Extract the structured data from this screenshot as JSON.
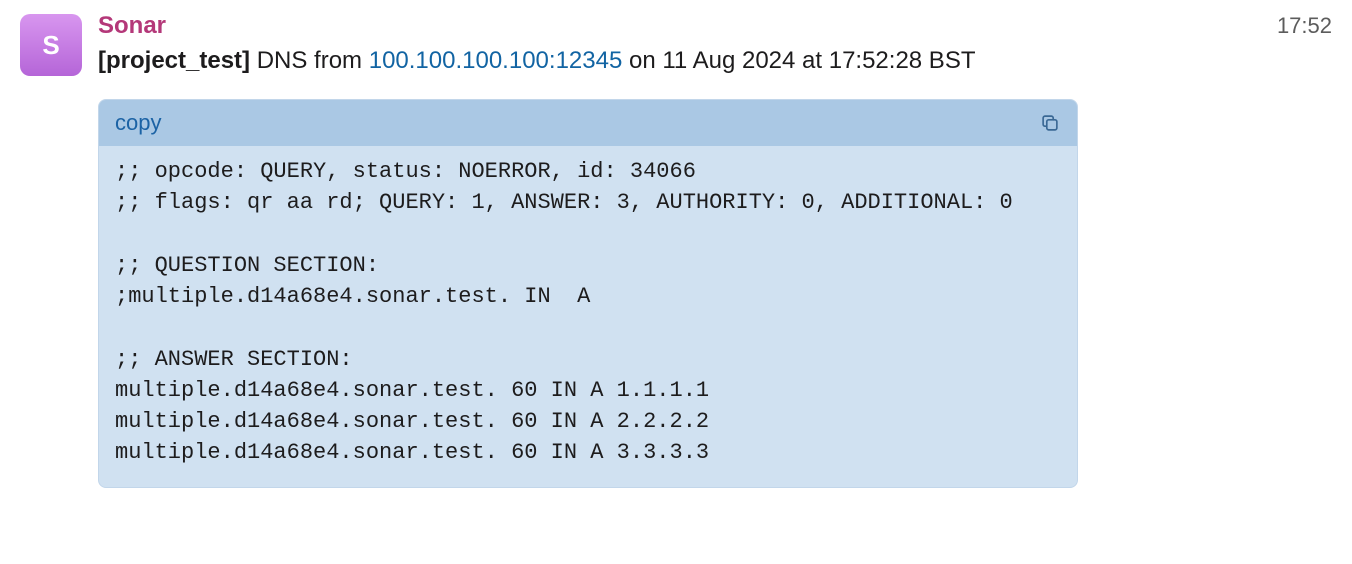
{
  "message": {
    "avatar_letter": "S",
    "sender": "Sonar",
    "timestamp": "17:52",
    "subject": {
      "prefix_bold": "[project_test]",
      "text_before_link": " DNS from ",
      "link": "100.100.100.100:12345",
      "text_after_link": " on 11 Aug 2024 at 17:52:28 BST"
    }
  },
  "code_block": {
    "copy_label": "copy",
    "content": ";; opcode: QUERY, status: NOERROR, id: 34066\n;; flags: qr aa rd; QUERY: 1, ANSWER: 3, AUTHORITY: 0, ADDITIONAL: 0\n\n;; QUESTION SECTION:\n;multiple.d14a68e4.sonar.test. IN  A\n\n;; ANSWER SECTION:\nmultiple.d14a68e4.sonar.test. 60 IN A 1.1.1.1\nmultiple.d14a68e4.sonar.test. 60 IN A 2.2.2.2\nmultiple.d14a68e4.sonar.test. 60 IN A 3.3.3.3"
  }
}
